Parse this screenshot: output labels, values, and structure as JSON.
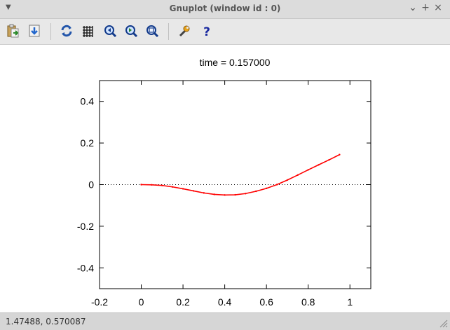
{
  "window": {
    "title": "Gnuplot (window id : 0)",
    "menu_icon": "chevron-down-icon",
    "minimize_icon": "minimize-icon",
    "maximize_icon": "maximize-icon",
    "close_icon": "close-icon"
  },
  "toolbar": {
    "buttons": [
      {
        "name": "copy-to-clipboard-button",
        "icon": "clipboard-icon"
      },
      {
        "name": "export-button",
        "icon": "save-icon"
      },
      {
        "name": "replot-button",
        "icon": "refresh-icon"
      },
      {
        "name": "grid-button",
        "icon": "grid-icon"
      },
      {
        "name": "previous-zoom-button",
        "icon": "zoom-back-icon"
      },
      {
        "name": "next-zoom-button",
        "icon": "zoom-forward-icon"
      },
      {
        "name": "autoscale-button",
        "icon": "zoom-fit-icon"
      },
      {
        "name": "settings-button",
        "icon": "wrench-icon"
      },
      {
        "name": "help-button",
        "icon": "help-icon"
      }
    ]
  },
  "status": {
    "coords": "1.47488,  0.570087"
  },
  "chart_data": {
    "type": "line",
    "title": "time = 0.157000",
    "xlabel": "",
    "ylabel": "",
    "xlim": [
      -0.2,
      1.1
    ],
    "ylim": [
      -0.5,
      0.5
    ],
    "xticks": [
      -0.2,
      0,
      0.2,
      0.4,
      0.6,
      0.8,
      1
    ],
    "yticks": [
      -0.4,
      -0.2,
      0,
      0.2,
      0.4
    ],
    "xtick_labels": [
      "-0.2",
      "0",
      "0.2",
      "0.4",
      "0.6",
      "0.8",
      "1"
    ],
    "ytick_labels": [
      "-0.4",
      "-0.2",
      "0",
      "0.2",
      "0.4"
    ],
    "grid": false,
    "zero_line": {
      "y": 0,
      "style": "dotted",
      "color": "#000000"
    },
    "series": [
      {
        "color": "#ff0000",
        "x": [
          0.0,
          0.05,
          0.1,
          0.15,
          0.2,
          0.25,
          0.3,
          0.35,
          0.4,
          0.45,
          0.5,
          0.55,
          0.6,
          0.65,
          0.7,
          0.75,
          0.8,
          0.85,
          0.9,
          0.95
        ],
        "y": [
          0.0,
          -0.001,
          -0.004,
          -0.011,
          -0.02,
          -0.03,
          -0.04,
          -0.047,
          -0.05,
          -0.049,
          -0.043,
          -0.032,
          -0.018,
          0.0,
          0.022,
          0.046,
          0.071,
          0.095,
          0.119,
          0.144
        ]
      }
    ]
  }
}
